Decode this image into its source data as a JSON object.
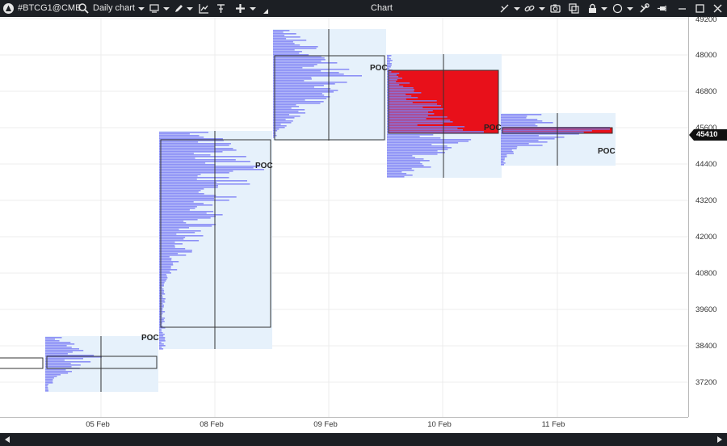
{
  "toolbar": {
    "symbol": "#BTCG1@CME",
    "timeframe": "Daily chart",
    "title": "Chart",
    "left_icons": [
      "app-logo-icon",
      "search-icon",
      "dropdown-arrow-icon",
      "chart-type-icon",
      "dropdown-arrow-icon",
      "pencil-icon",
      "dropdown-arrow-icon",
      "indicators-icon",
      "templates-icon",
      "plus-icon",
      "dropdown-arrow-icon"
    ],
    "right_icons": [
      "crosshair-icon",
      "dropdown-arrow-icon",
      "link-icon",
      "dropdown-arrow-icon",
      "camera-icon",
      "copy-window-icon",
      "lock-icon",
      "dropdown-arrow-icon",
      "color-circle-icon",
      "dropdown-arrow-icon",
      "settings-wrench-icon",
      "pin-icon",
      "minimize-icon",
      "maximize-icon",
      "close-icon"
    ]
  },
  "price_axis": {
    "labels": [
      "49200",
      "48000",
      "46800",
      "45600",
      "44400",
      "43200",
      "42000",
      "40800",
      "39600",
      "38400",
      "37200"
    ],
    "current_price": "45410",
    "current_price_color": "#101010"
  },
  "time_axis": {
    "labels": [
      "05 Feb",
      "08 Feb",
      "09 Feb",
      "10 Feb",
      "11 Feb"
    ]
  },
  "profiles": [
    {
      "date": "05 Feb",
      "poc_label": "POC"
    },
    {
      "date": "08 Feb",
      "poc_label": "POC"
    },
    {
      "date": "09 Feb",
      "poc_label": "POC"
    },
    {
      "date": "10 Feb",
      "poc_label": "POC"
    },
    {
      "date": "11 Feb",
      "poc_label": "POC"
    }
  ],
  "colors": {
    "background": "#ffffff",
    "toolbar": "#1c1f24",
    "profile_fill": "#e6f1fb",
    "volume_bar": "#7b7ff5",
    "value_area_red": "#e8101a",
    "grid": "#ececec"
  }
}
